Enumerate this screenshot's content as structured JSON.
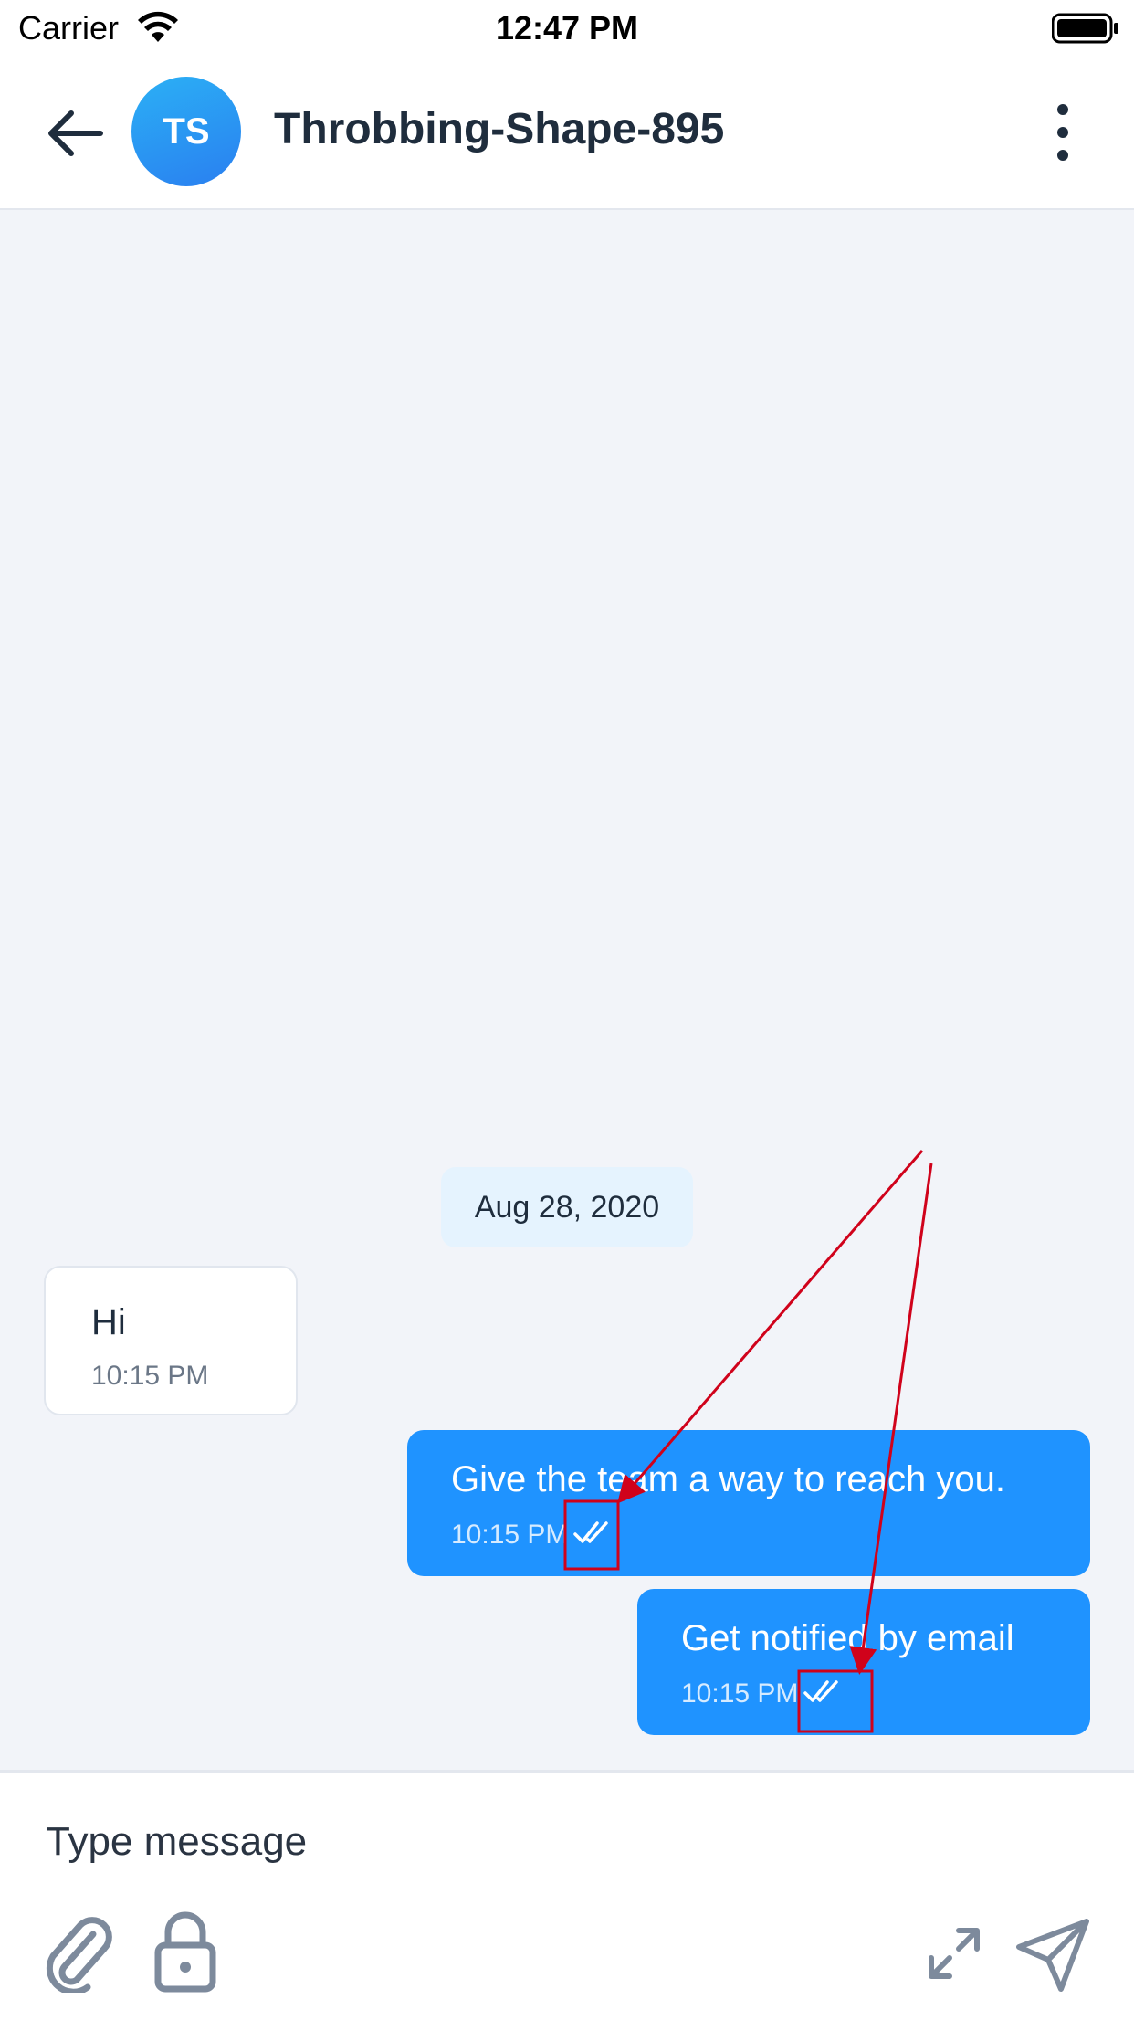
{
  "status_bar": {
    "carrier": "Carrier",
    "time": "12:47 PM"
  },
  "header": {
    "avatar_initials": "TS",
    "contact_name": "Throbbing-Shape-895",
    "avatar_gradient": [
      "#2bb0f5",
      "#2a7ff0"
    ]
  },
  "conversation": {
    "date_separator": "Aug 28, 2020",
    "messages": [
      {
        "direction": "incoming",
        "text": "Hi",
        "time": "10:15 PM"
      },
      {
        "direction": "outgoing",
        "text": "Give the team a way to reach you.",
        "time": "10:15 PM",
        "status_icon": "double-check-icon"
      },
      {
        "direction": "outgoing",
        "text": "Get notified by email",
        "time": "10:15 PM",
        "status_icon": "double-check-icon"
      }
    ]
  },
  "composer": {
    "placeholder": "Type message",
    "icons": [
      "paperclip-icon",
      "lock-icon",
      "expand-icon",
      "send-icon"
    ]
  },
  "colors": {
    "outgoing_bubble": "#1f93ff",
    "incoming_bubble": "#ffffff",
    "chat_background": "#f2f4f9",
    "date_chip": "#e5f3fe",
    "annotation": "#d0021b"
  }
}
